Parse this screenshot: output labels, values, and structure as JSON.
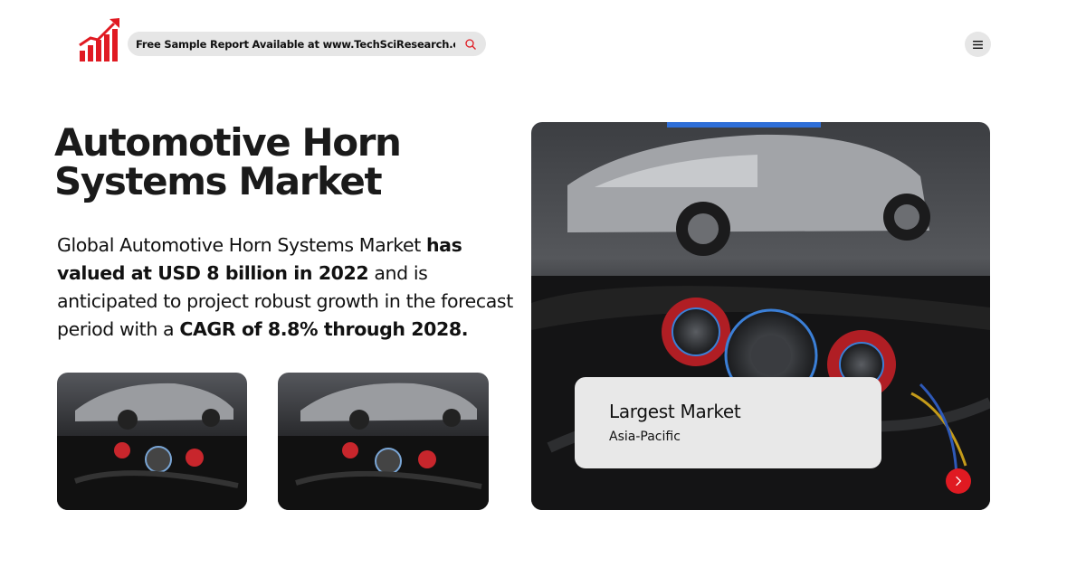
{
  "header": {
    "search_text": "Free Sample Report Available at www.TechSciResearch.com"
  },
  "title": "Automotive Horn Systems Market",
  "description": {
    "part1": "Global Automotive Horn Systems Market ",
    "bold1": "has valued at USD 8 billion in 2022",
    "part2": " and is anticipated to project robust growth in the forecast period with a ",
    "bold2": "CAGR of 8.8% through 2028."
  },
  "info_card": {
    "label": "Largest Market",
    "value": "Asia-Pacific"
  },
  "colors": {
    "accent": "#e01a22",
    "pill_bg": "#e6e6e6",
    "card_bg": "#e8e8e8"
  },
  "icons": {
    "logo": "bar-chart-growth-icon",
    "search": "search-icon",
    "menu": "hamburger-menu-icon",
    "next": "chevron-right-icon"
  }
}
